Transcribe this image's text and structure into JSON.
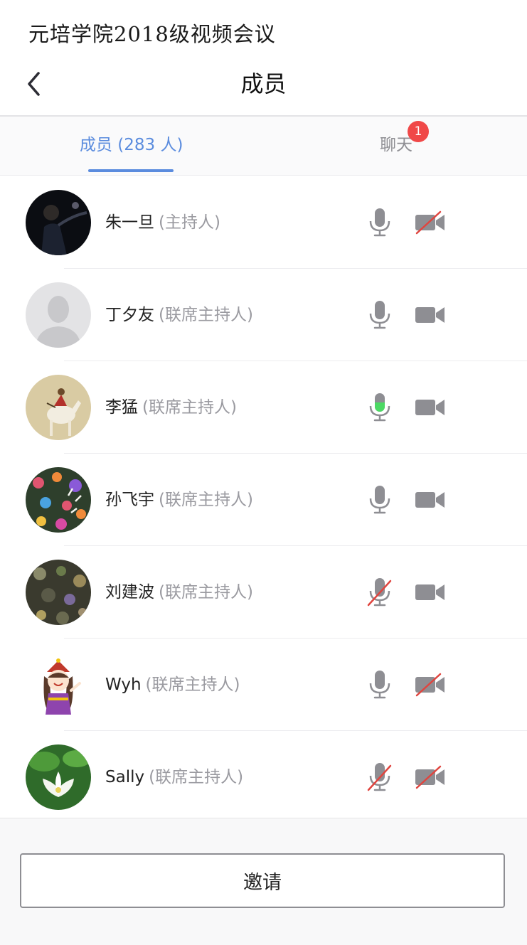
{
  "header": {
    "caption": "元培学院2018级视频会议",
    "title": "成员"
  },
  "tabs": {
    "members_label": "成员 (283 人)",
    "chat_label": "聊天",
    "chat_badge": "1"
  },
  "colors": {
    "accent": "#5b8cde",
    "badge": "#f04848",
    "icon_gray": "#8e8e93",
    "muted_slash": "#e0453f",
    "speaking": "#4cd964"
  },
  "members": [
    {
      "name": "朱一旦",
      "role": "(主持人)",
      "avatar": "dark-photo-avatar",
      "mic": "on",
      "camera": "off"
    },
    {
      "name": "丁夕友",
      "role": "(联席主持人)",
      "avatar": "default-person-avatar",
      "mic": "on",
      "camera": "on"
    },
    {
      "name": "李猛",
      "role": "(联席主持人)",
      "avatar": "painting-horse-avatar",
      "mic": "speaking",
      "camera": "on"
    },
    {
      "name": "孙飞宇",
      "role": "(联席主持人)",
      "avatar": "flowers-avatar",
      "mic": "on",
      "camera": "on"
    },
    {
      "name": "刘建波",
      "role": "(联席主持人)",
      "avatar": "dark-pattern-avatar",
      "mic": "off",
      "camera": "on"
    },
    {
      "name": "Wyh",
      "role": "(联席主持人)",
      "avatar": "cartoon-girl-avatar",
      "mic": "on",
      "camera": "off"
    },
    {
      "name": "Sally",
      "role": "(联席主持人)",
      "avatar": "lotus-avatar",
      "mic": "off",
      "camera": "off"
    }
  ],
  "footer": {
    "invite_label": "邀请"
  }
}
